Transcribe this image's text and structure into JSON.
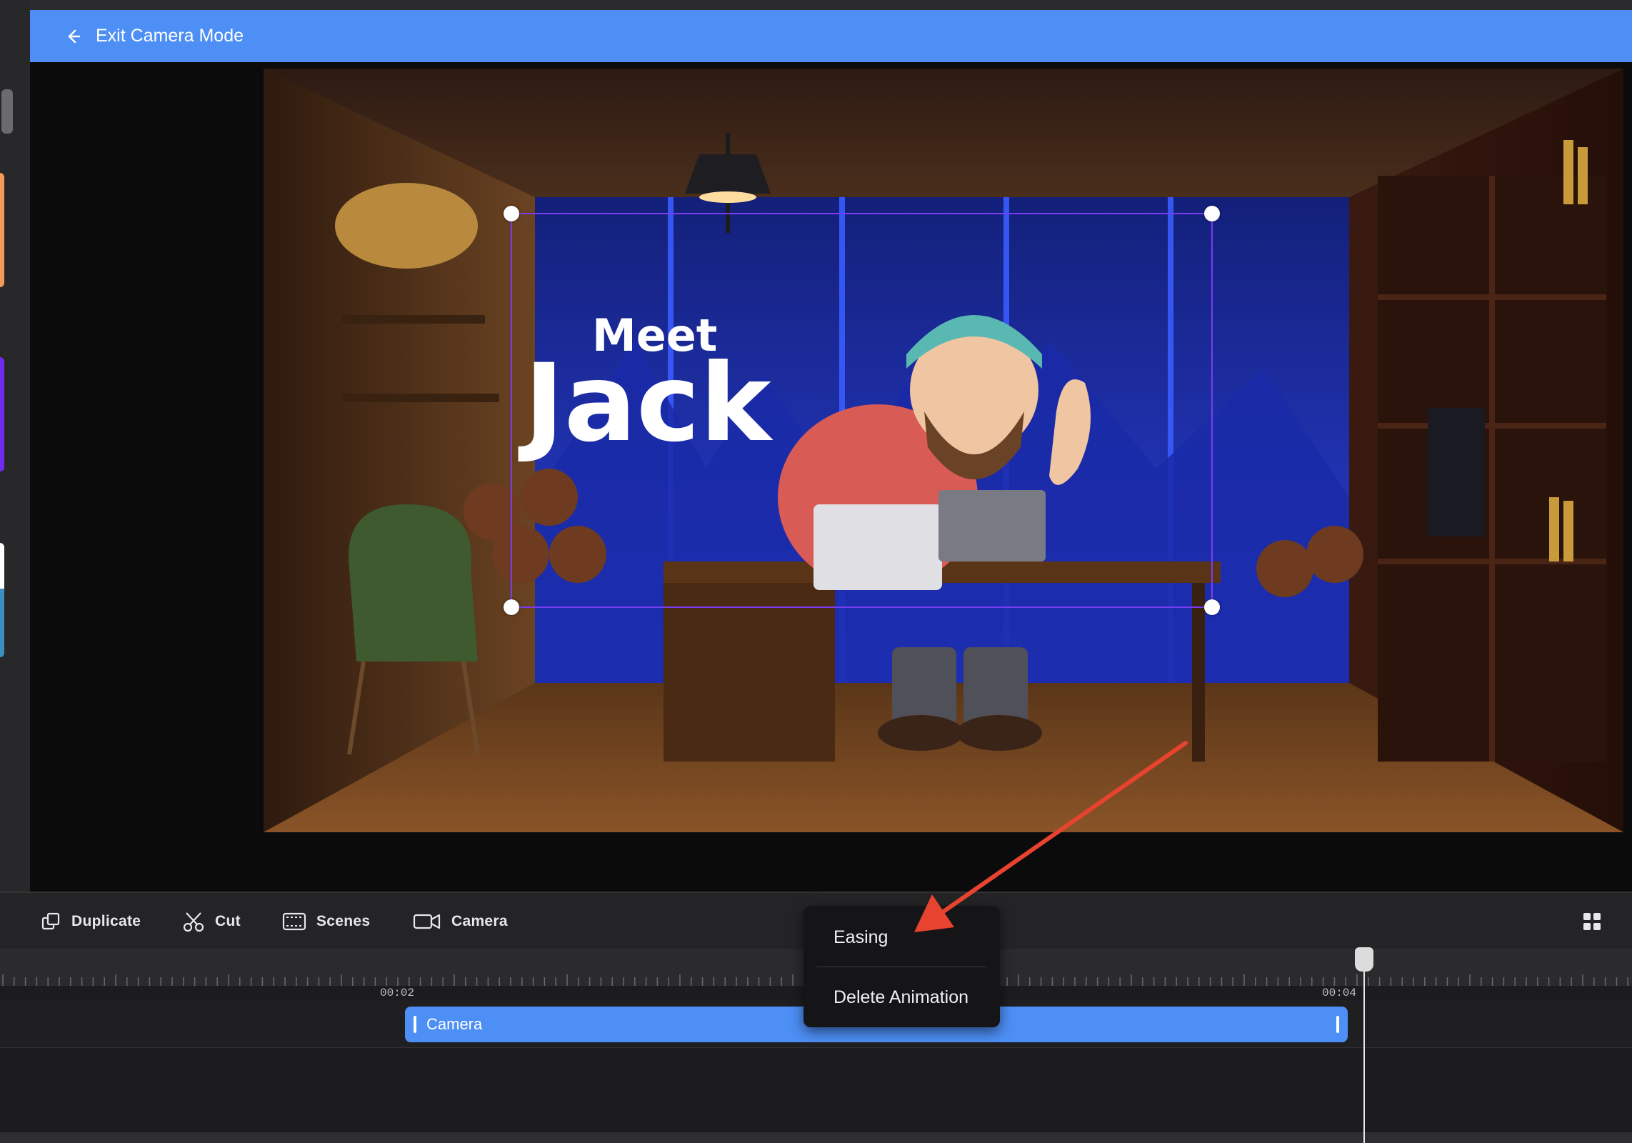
{
  "header": {
    "title": "Exit Camera Mode",
    "back_icon": "arrow-left-icon"
  },
  "scene": {
    "title_line1": "Meet",
    "title_line2": "Jack"
  },
  "toolbar": {
    "duplicate": "Duplicate",
    "cut": "Cut",
    "scenes": "Scenes",
    "camera": "Camera",
    "grid_icon": "grid-icon"
  },
  "timeline": {
    "ticks": [
      "00:02",
      "00:04"
    ],
    "clip_label": "Camera"
  },
  "context_menu": {
    "items": [
      "Easing",
      "Delete Animation"
    ]
  },
  "colors": {
    "accent": "#4d8ff5",
    "frame": "#7a3cf0",
    "annotation": "#e8432e"
  }
}
